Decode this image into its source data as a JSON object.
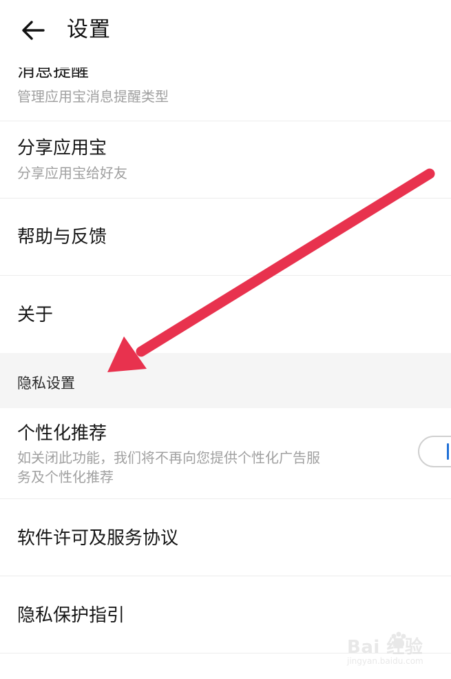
{
  "header": {
    "title": "设置"
  },
  "items": [
    {
      "title": "消息提醒",
      "subtitle": "管理应用宝消息提醒类型"
    },
    {
      "title": "分享应用宝",
      "subtitle": "分享应用宝给好友"
    },
    {
      "title": "帮助与反馈"
    },
    {
      "title": "关于"
    }
  ],
  "section": {
    "label": "隐私设置"
  },
  "privacy_items": [
    {
      "title": "个性化推荐",
      "subtitle_line1": "如关闭此功能，我们将不再向您提供个性化广告服",
      "subtitle_line2": "务及个性化推荐",
      "toggle_on": false
    },
    {
      "title": "软件许可及服务协议"
    },
    {
      "title": "隐私保护指引"
    }
  ],
  "watermark": {
    "brand": "Bai  经验",
    "domain": "jingyan.baidu.com"
  },
  "colors": {
    "annotation_arrow": "#e8324e",
    "section_bg": "#f5f5f5",
    "subtitle_text": "#a0a0a0"
  },
  "icons": {
    "back": "arrow-left-icon"
  }
}
